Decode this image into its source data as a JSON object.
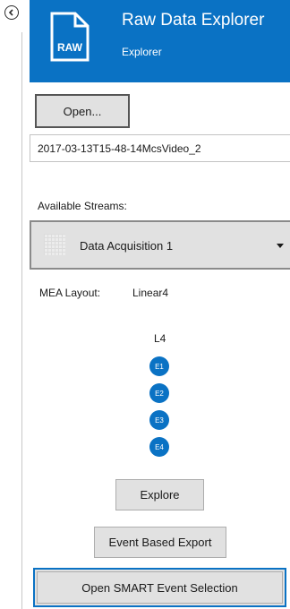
{
  "header": {
    "title": "Raw Data Explorer",
    "subtitle": "Explorer",
    "icon_text": "RAW",
    "color": "#0a72c4"
  },
  "toolbar": {
    "back_icon": "chevron-left-icon",
    "open_label": "Open..."
  },
  "file": {
    "name": "2017-03-13T15-48-14McsVideo_2"
  },
  "streams": {
    "label": "Available Streams:",
    "selected": "Data Acquisition 1"
  },
  "mea": {
    "layout_label": "MEA Layout:",
    "layout_value": "Linear4",
    "group_label": "L4",
    "electrodes": [
      "E1",
      "E2",
      "E3",
      "E4"
    ]
  },
  "actions": {
    "explore_label": "Explore",
    "event_export_label": "Event Based Export",
    "smart_label": "Open SMART Event Selection"
  }
}
